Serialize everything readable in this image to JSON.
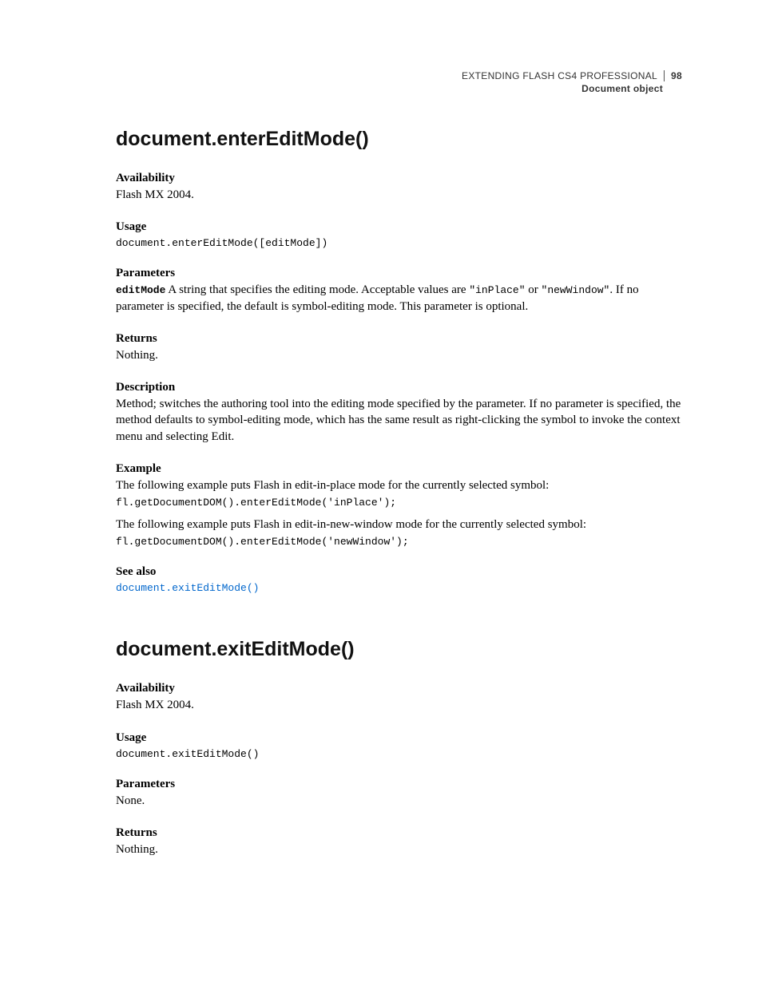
{
  "header": {
    "book": "EXTENDING FLASH CS4 PROFESSIONAL",
    "page": "98",
    "section": "Document object"
  },
  "m1": {
    "title": "document.enterEditMode()",
    "availability_h": "Availability",
    "availability": "Flash MX 2004.",
    "usage_h": "Usage",
    "usage_code": "document.enterEditMode([editMode])",
    "parameters_h": "Parameters",
    "param_name": "editMode",
    "param_text_a": "  A string that specifies the editing mode. Acceptable values are ",
    "param_lit1": "\"inPlace\"",
    "param_text_b": " or ",
    "param_lit2": "\"newWindow\"",
    "param_text_c": ". If no parameter is specified, the default is symbol-editing mode. This parameter is optional.",
    "returns_h": "Returns",
    "returns": "Nothing.",
    "description_h": "Description",
    "description": "Method; switches the authoring tool into the editing mode specified by the parameter. If no parameter is specified, the method defaults to symbol-editing mode, which has the same result as right-clicking the symbol to invoke the context menu and selecting Edit.",
    "example_h": "Example",
    "example_intro1": "The following example puts Flash in edit-in-place mode for the currently selected symbol:",
    "example_code1": "fl.getDocumentDOM().enterEditMode('inPlace');",
    "example_intro2": "The following example puts Flash in edit-in-new-window mode for the currently selected symbol:",
    "example_code2": "fl.getDocumentDOM().enterEditMode('newWindow');",
    "seealso_h": "See also",
    "seealso_link": "document.exitEditMode()"
  },
  "m2": {
    "title": "document.exitEditMode()",
    "availability_h": "Availability",
    "availability": "Flash MX 2004.",
    "usage_h": "Usage",
    "usage_code": "document.exitEditMode()",
    "parameters_h": "Parameters",
    "parameters": "None.",
    "returns_h": "Returns",
    "returns": "Nothing."
  }
}
